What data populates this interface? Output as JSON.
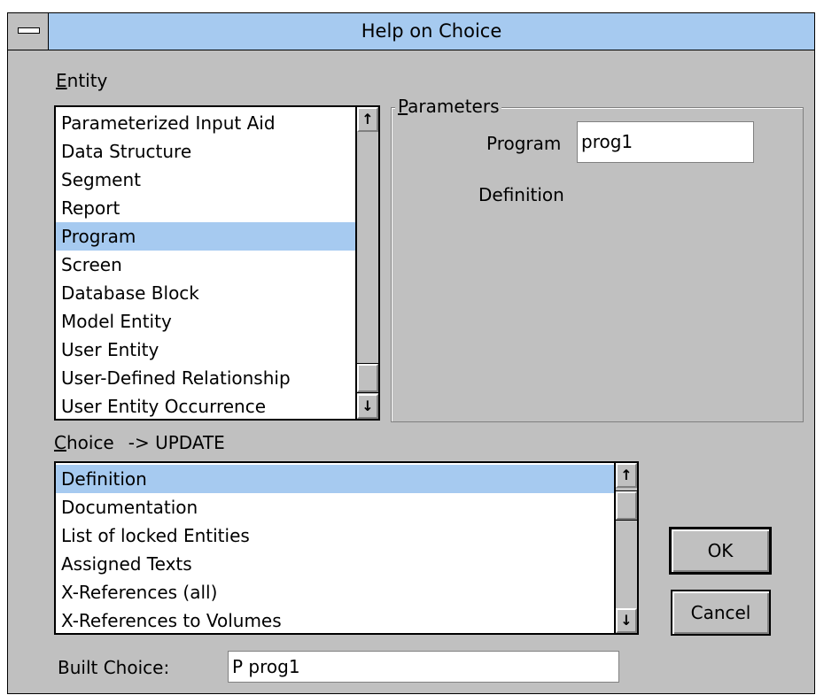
{
  "window": {
    "title": "Help on Choice"
  },
  "entity": {
    "label_prefix": "E",
    "label_rest": "ntity",
    "items": [
      "Parameterized Input Aid",
      "Data Structure",
      "Segment",
      "Report",
      "Program",
      "Screen",
      "Database Block",
      "Model Entity",
      "User Entity",
      "User-Defined Relationship",
      "User Entity Occurrence"
    ],
    "selected": "Program"
  },
  "parameters": {
    "label_prefix": "P",
    "label_rest": "arameters",
    "program_label": "Program",
    "program_value": "prog1",
    "definition_label": "Definition"
  },
  "choice": {
    "label_prefix": "C",
    "label_rest": "hoice",
    "mode": "-> UPDATE",
    "items": [
      "Definition",
      "Documentation",
      "List of locked Entities",
      "Assigned Texts",
      "X-References (all)",
      "X-References to Volumes"
    ],
    "selected": "Definition"
  },
  "built_choice": {
    "label": "Built Choice:",
    "value": "P prog1"
  },
  "buttons": {
    "ok": "OK",
    "cancel": "Cancel"
  },
  "scroll": {
    "up_glyph": "↑",
    "down_glyph": "↓"
  },
  "colors": {
    "selection": "#a6caf0",
    "face": "#c0c0c0"
  }
}
